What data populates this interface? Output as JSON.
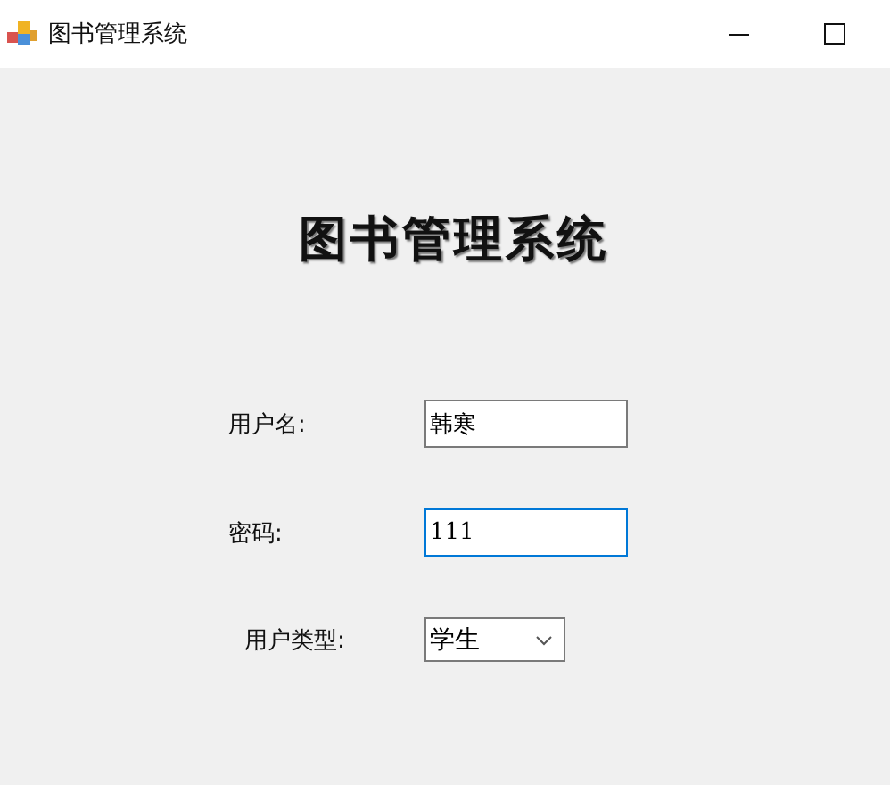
{
  "window": {
    "title": "图书管理系统"
  },
  "heading": "图书管理系统",
  "fields": [
    {
      "kind": "text",
      "label": "用户名:",
      "value": "韩寒",
      "focused": false
    },
    {
      "kind": "text",
      "label": "密码:",
      "value": "111",
      "focused": true
    },
    {
      "kind": "select",
      "label": "用户类型:",
      "value": "学生",
      "focused": false
    }
  ]
}
